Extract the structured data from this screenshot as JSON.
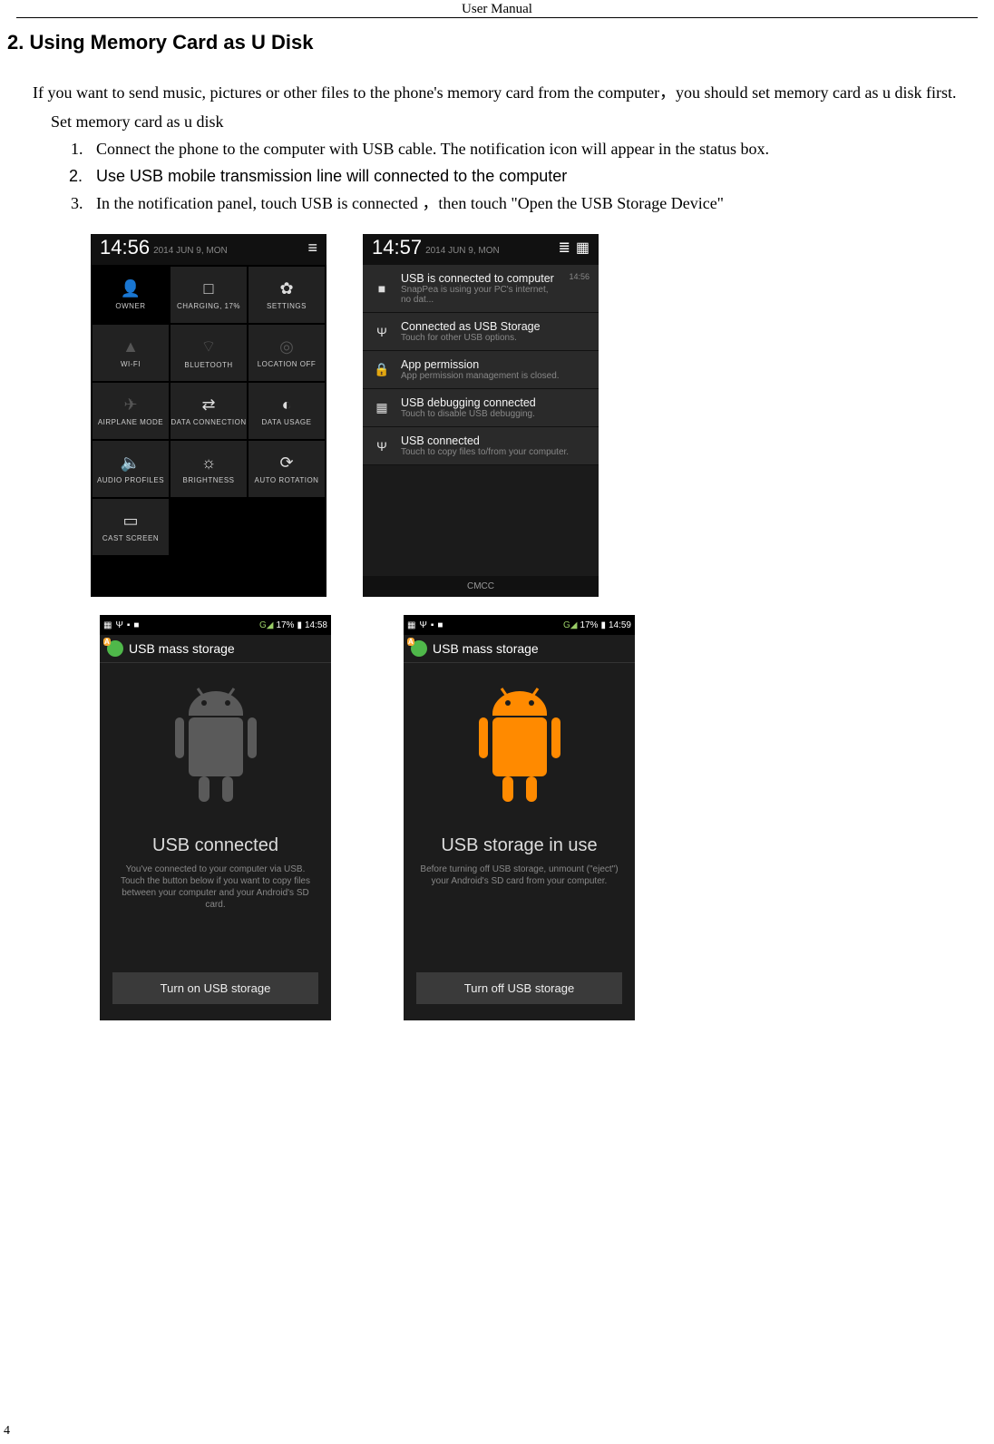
{
  "header": "User    Manual",
  "section_title": "2. Using Memory Card as U Disk",
  "intro": "If you want to send music, pictures or other files to the phone's memory card from the computer，you should set memory card as u disk first.",
  "subhead": "Set memory card as u disk",
  "steps": [
    "Connect the phone to the computer with USB cable. The notification icon will appear in the status box.",
    "Use USB mobile transmission line will connected to the computer",
    "In the notification panel, touch USB is connected  ，then touch \"Open the USB Storage Device\""
  ],
  "shotA": {
    "time": "14:56",
    "date": "2014 JUN 9, MON",
    "tiles": [
      {
        "label": "OWNER",
        "icon": "👤",
        "cls": "dark"
      },
      {
        "label": "CHARGING, 17%",
        "icon": "□"
      },
      {
        "label": "SETTINGS",
        "icon": "✿"
      },
      {
        "label": "WI-FI",
        "icon": "▲",
        "dim": true
      },
      {
        "label": "BLUETOOTH",
        "icon": "⌔",
        "dim": true
      },
      {
        "label": "LOCATION OFF",
        "icon": "◎",
        "dim": true
      },
      {
        "label": "AIRPLANE MODE",
        "icon": "✈",
        "dim": true
      },
      {
        "label": "DATA\nCONNECTION",
        "icon": "⇄"
      },
      {
        "label": "DATA USAGE",
        "icon": "◐"
      },
      {
        "label": "AUDIO PROFILES",
        "icon": "🔈"
      },
      {
        "label": "BRIGHTNESS",
        "icon": "☼"
      },
      {
        "label": "AUTO ROTATION",
        "icon": "⟳"
      },
      {
        "label": "CAST SCREEN",
        "icon": "▭"
      }
    ]
  },
  "shotB": {
    "time": "14:57",
    "date": "2014 JUN 9, MON",
    "carrier": "CMCC",
    "notifs": [
      {
        "icon": "■",
        "title": "USB is connected to computer",
        "sub": "SnapPea is using your PC's internet, no dat...",
        "time": "14:56"
      },
      {
        "icon": "Ψ",
        "title": "Connected as USB Storage",
        "sub": "Touch for other USB options."
      },
      {
        "icon": "🔒",
        "title": "App permission",
        "sub": "App permission management is closed."
      },
      {
        "icon": "▦",
        "title": "USB debugging connected",
        "sub": "Touch to disable USB debugging."
      },
      {
        "icon": "Ψ",
        "title": "USB connected",
        "sub": "Touch to copy files to/from your computer."
      }
    ]
  },
  "shotC": {
    "status_left": [
      "▦",
      "Ψ",
      "▪",
      "■"
    ],
    "status_right_signal": "G◢",
    "battery": "17%",
    "clock": "14:58",
    "app_title": "USB mass storage",
    "heading": "USB connected",
    "sub": "You've connected to your computer via USB. Touch the button below if you want to copy files between your computer and your Android's SD card.",
    "button": "Turn on USB storage",
    "droid_color": "#5a5a5a"
  },
  "shotD": {
    "status_left": [
      "▦",
      "Ψ",
      "▪",
      "■"
    ],
    "status_right_signal": "G◢",
    "battery": "17%",
    "clock": "14:59",
    "app_title": "USB mass storage",
    "heading": "USB storage in use",
    "sub": "Before turning off USB storage, unmount (\"eject\") your Android's SD card from your computer.",
    "button": "Turn off USB storage",
    "droid_color": "#ff8a00"
  },
  "page_number": "4"
}
